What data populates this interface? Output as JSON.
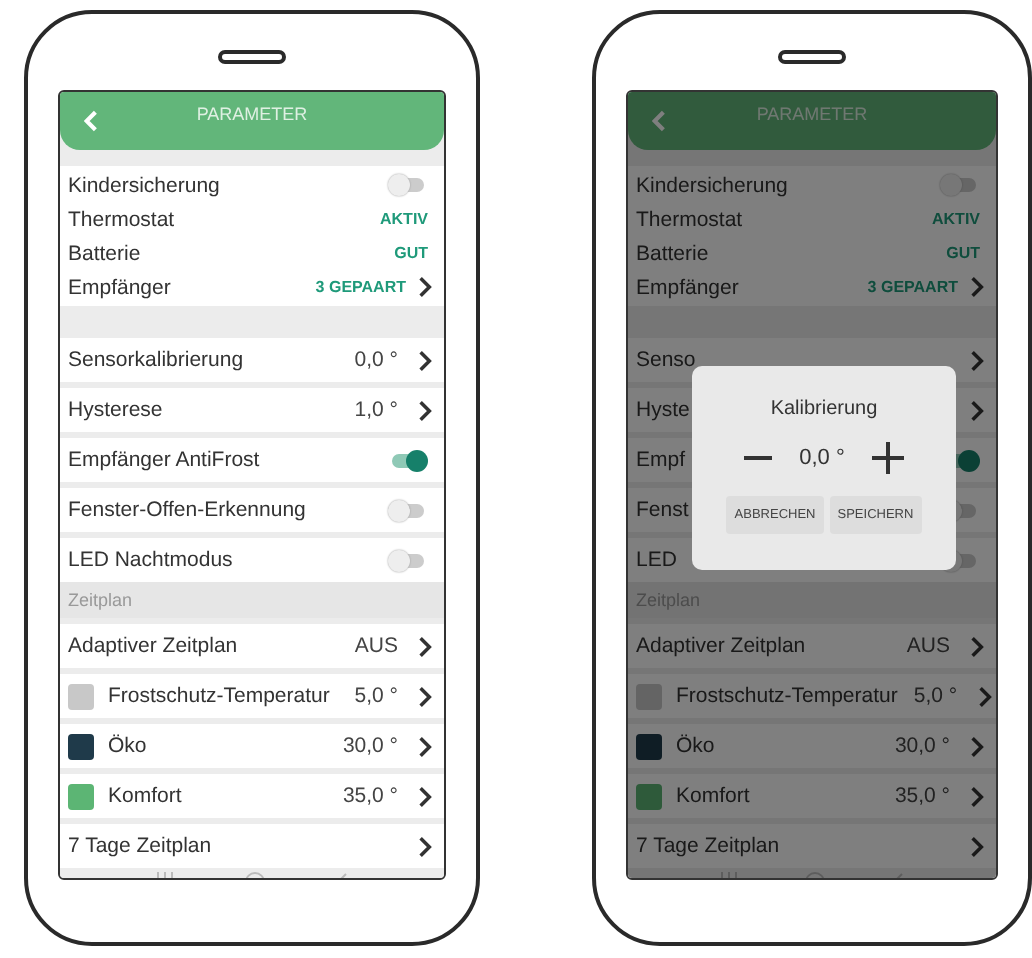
{
  "phones": [
    {
      "dimmed": false,
      "screen": {
        "title": "PARAMETER",
        "groups": [
          {
            "rows": [
              {
                "kind": "toggle",
                "label": "Kindersicherung",
                "on": false
              },
              {
                "kind": "status",
                "label": "Thermostat",
                "value": "AKTIV"
              },
              {
                "kind": "status",
                "label": "Batterie",
                "value": "GUT"
              },
              {
                "kind": "status_link",
                "label": "Empfänger",
                "value": "3 GEPAART"
              }
            ]
          },
          {
            "rows": [
              {
                "kind": "link",
                "label": "Sensorkalibrierung",
                "value": "0,0 °"
              }
            ]
          },
          {
            "rows": [
              {
                "kind": "link",
                "label": "Hysterese",
                "value": "1,0 °"
              }
            ]
          },
          {
            "rows": [
              {
                "kind": "toggle",
                "label": "Empfänger AntiFrost",
                "on": true
              }
            ]
          },
          {
            "rows": [
              {
                "kind": "toggle",
                "label": "Fenster-Offen-Erkennung",
                "on": false
              }
            ]
          },
          {
            "rows": [
              {
                "kind": "toggle",
                "label": "LED Nachtmodus",
                "on": false
              }
            ]
          },
          {
            "rows": [
              {
                "kind": "section",
                "label": "Zeitplan"
              }
            ]
          },
          {
            "rows": [
              {
                "kind": "link",
                "label": "Adaptiver Zeitplan",
                "value": "AUS"
              }
            ]
          },
          {
            "rows": [
              {
                "kind": "swatch",
                "label": "Frostschutz-Temperatur",
                "value": "5,0 °",
                "color": "#c8c8c8"
              }
            ]
          },
          {
            "rows": [
              {
                "kind": "swatch",
                "label": "Öko",
                "value": "30,0 °",
                "color": "#1f3a4a"
              }
            ]
          },
          {
            "rows": [
              {
                "kind": "swatch",
                "label": "Komfort",
                "value": "35,0 °",
                "color": "#5cb574"
              }
            ]
          },
          {
            "rows": [
              {
                "kind": "link",
                "label": "7 Tage Zeitplan"
              }
            ]
          }
        ]
      }
    },
    {
      "dimmed": true,
      "screen": {
        "title": "PARAMETER",
        "groups": [
          {
            "rows": [
              {
                "kind": "toggle",
                "label": "Kindersicherung",
                "on": false
              },
              {
                "kind": "status",
                "label": "Thermostat",
                "value": "AKTIV"
              },
              {
                "kind": "status",
                "label": "Batterie",
                "value": "GUT"
              },
              {
                "kind": "status_link",
                "label": "Empfänger",
                "value": "3 GEPAART"
              }
            ]
          },
          {
            "rows": [
              {
                "kind": "link",
                "label": "Senso"
              }
            ]
          },
          {
            "rows": [
              {
                "kind": "link",
                "label": "Hyste"
              }
            ]
          },
          {
            "rows": [
              {
                "kind": "toggle",
                "label": "Empf",
                "on": true
              }
            ]
          },
          {
            "rows": [
              {
                "kind": "toggle",
                "label": "Fenst",
                "on": false
              }
            ]
          },
          {
            "rows": [
              {
                "kind": "toggle",
                "label": "LED",
                "on": false
              }
            ]
          },
          {
            "rows": [
              {
                "kind": "section",
                "label": "Zeitplan"
              }
            ]
          },
          {
            "rows": [
              {
                "kind": "link",
                "label": "Adaptiver Zeitplan",
                "value": "AUS"
              }
            ]
          },
          {
            "rows": [
              {
                "kind": "swatch",
                "label": "Frostschutz-Temperatur",
                "value": "5,0 °",
                "color": "#646464"
              }
            ]
          },
          {
            "rows": [
              {
                "kind": "swatch",
                "label": "Öko",
                "value": "30,0 °",
                "color": "#0f1d25"
              }
            ]
          },
          {
            "rows": [
              {
                "kind": "swatch",
                "label": "Komfort",
                "value": "35,0 °",
                "color": "#2e5a3a"
              }
            ]
          },
          {
            "rows": [
              {
                "kind": "link",
                "label": "7 Tage Zeitplan"
              }
            ]
          }
        ]
      },
      "dialog": {
        "title": "Kalibrierung",
        "value": "0,0 °",
        "buttons": [
          "ABBRECHEN",
          "SPEICHERN"
        ]
      }
    }
  ]
}
